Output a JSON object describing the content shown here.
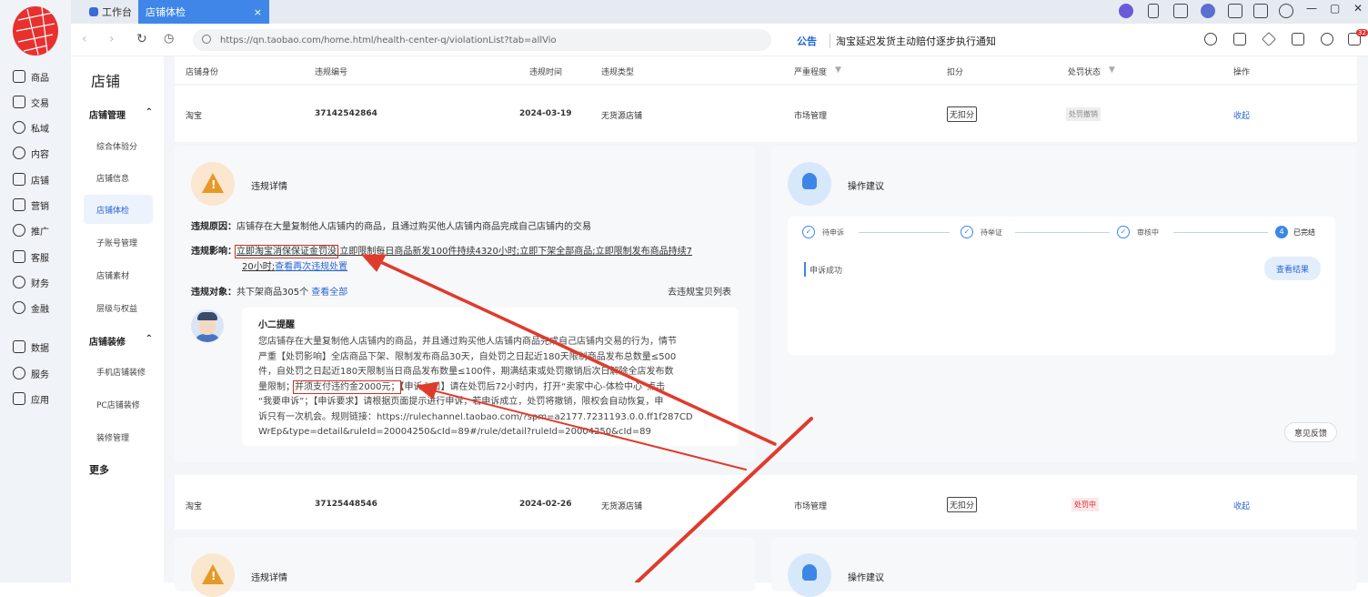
{
  "browser": {
    "tabs": [
      {
        "label": "工作台"
      },
      {
        "label": "店铺体检",
        "close": "×"
      }
    ],
    "window_controls": {
      "minimize": "—",
      "restore": "▢",
      "close": "✕"
    },
    "url": "https://qn.taobao.com/home.html/health-center-q/violationList?tab=allVio",
    "notice": {
      "tag": "公告",
      "text": "淘宝延迟发货主动赔付逐步执行通知"
    },
    "badge_count": "32"
  },
  "rail": {
    "items": [
      {
        "label": "商品"
      },
      {
        "label": "交易"
      },
      {
        "label": "私域"
      },
      {
        "label": "内容"
      },
      {
        "label": "店铺"
      },
      {
        "label": "营销"
      },
      {
        "label": "推广"
      },
      {
        "label": "客服"
      },
      {
        "label": "财务"
      },
      {
        "label": "金融"
      },
      {
        "label": "数据"
      },
      {
        "label": "服务"
      },
      {
        "label": "应用"
      }
    ]
  },
  "subnav": {
    "title": "店铺",
    "group1": {
      "label": "店铺管理",
      "caret": "⌃"
    },
    "group1_items": [
      "综合体验分",
      "店铺信息",
      "店铺体检",
      "子账号管理",
      "店铺素材",
      "层级与权益"
    ],
    "group2": {
      "label": "店铺装修",
      "caret": "⌃"
    },
    "group2_items": [
      "手机店铺装修",
      "PC店铺装修",
      "装修管理"
    ],
    "more": "更多"
  },
  "table": {
    "headers": [
      "店铺身份",
      "违规编号",
      "违规时间",
      "违规类型",
      "严重程度",
      "扣分",
      "处罚状态",
      "操作"
    ],
    "rows": [
      {
        "identity": "淘宝",
        "id": "37142542864",
        "date": "2024-03-19",
        "type": "无货源店铺",
        "severity": "市场管理",
        "points": "无扣分",
        "status": "处罚撤销",
        "action": "收起"
      },
      {
        "identity": "淘宝",
        "id": "37125448546",
        "date": "2024-02-26",
        "type": "无货源店铺",
        "severity": "市场管理",
        "points": "无扣分",
        "status": "处罚中",
        "action": "收起"
      }
    ]
  },
  "detail": {
    "title": "违规详情",
    "reason_label": "违规原因：",
    "reason": "店铺存在大量复制他人店铺内的商品，且通过购买他人店铺内商品完成自己店铺内的交易",
    "impact_label": "违规影响：",
    "impact_boxed": "立即淘宝消保保证金罚没",
    "impact_rest_1": ";立即限制每日商品新发100件持续4320小时;立即下架全部商品;立即限制发布商品持续7",
    "impact_rest_2": "20小时;",
    "impact_link": "查看再次违规处置",
    "target_label": "违规对象：",
    "target": "共下架商品305个",
    "target_link": "查看全部",
    "list_link": "去违规宝贝列表",
    "reminder": {
      "title": "小二提醒",
      "l1": "您店铺存在大量复制他人店铺内的商品，并且通过购买他人店铺内商品完成自己店铺内交易的行为，情节",
      "l2": "严重【处罚影响】全店商品下架、限制发布商品30天，自处罚之日起近180天限制商品发布总数量≤500",
      "l3": "件，自处罚之日起近180天限制当日商品发布数量≤100件，期满结束或处罚撤销后次日解除全店发布数",
      "l4a": "量限制；",
      "l4box": "并须支付违约金2000元；",
      "l4b": "【申诉入口】请在处罚后72小时内，打开“卖家中心-体检中心”点击",
      "l5": "“我要申诉”；【申诉要求】请根据页面提示进行申诉，若申诉成立，处罚将撤销，限权会自动恢复，申",
      "l6": "诉只有一次机会。规则链接：https://rulechannel.taobao.com/?spm=a2177.7231193.0.0.ff1f287CD",
      "l7": "WrEp&type=detail&ruleId=20004250&cId=89#/rule/detail?ruleId=20004250&cId=89"
    }
  },
  "suggestion": {
    "title": "操作建议",
    "steps": [
      {
        "label": "待申诉",
        "mark": "✓"
      },
      {
        "label": "待举证",
        "mark": "✓"
      },
      {
        "label": "审核中",
        "mark": "✓"
      },
      {
        "label": "已完结",
        "mark": "4"
      }
    ],
    "result": "申诉成功",
    "view_button": "查看结果",
    "feedback_button": "意见反馈"
  },
  "second": {
    "detail_title": "违规详情",
    "suggestion_title": "操作建议"
  },
  "colors": {
    "accent": "#3f86e8",
    "annotation": "#d03020"
  }
}
